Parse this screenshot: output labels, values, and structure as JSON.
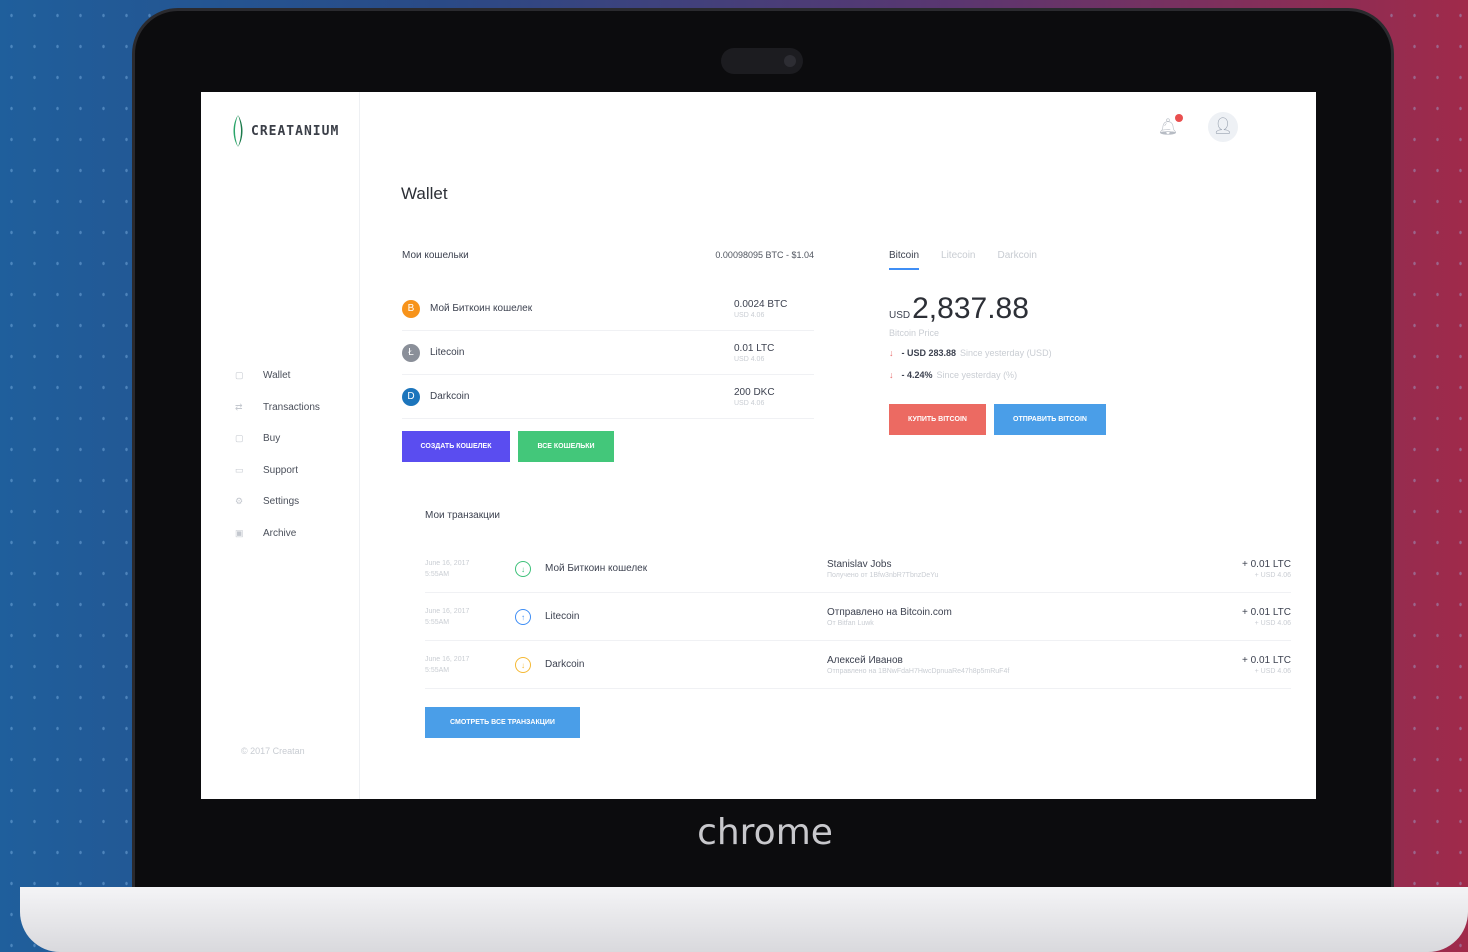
{
  "device_brand": "chrome",
  "brand": {
    "name": "CREATANIUM"
  },
  "sidebar": {
    "items": [
      {
        "icon": "wallet-icon",
        "label": "Wallet"
      },
      {
        "icon": "transactions-icon",
        "label": "Transactions"
      },
      {
        "icon": "buy-icon",
        "label": "Buy"
      },
      {
        "icon": "support-icon",
        "label": "Support"
      },
      {
        "icon": "settings-icon",
        "label": "Settings"
      },
      {
        "icon": "archive-icon",
        "label": "Archive"
      }
    ],
    "copyright": "© 2017 Creatan"
  },
  "header": {
    "notification_icon": "bell-icon",
    "avatar_icon": "user-icon"
  },
  "page": {
    "title": "Wallet"
  },
  "wallets": {
    "title": "Мои кошельки",
    "total": "0.00098095 BTC - $1.04",
    "rows": [
      {
        "name": "Мой Биткоин кошелек",
        "amount": "0.0024 BTC",
        "usd": "USD 4.06",
        "coin_color": "#f7931a",
        "glyph": "B"
      },
      {
        "name": "Litecoin",
        "amount": "0.01 LTC",
        "usd": "USD 4.06",
        "coin_color": "#8a8f99",
        "glyph": "Ł"
      },
      {
        "name": "Darkcoin",
        "amount": "200 DKC",
        "usd": "USD 4.06",
        "coin_color": "#1c75bc",
        "glyph": "D"
      }
    ],
    "btn_create": "СОЗДАТЬ КОШЕЛЕК",
    "btn_all": "ВСЕ КОШЕЛЬКИ"
  },
  "price": {
    "tabs": [
      "Bitcoin",
      "Litecoin",
      "Darkcoin"
    ],
    "currency": "USD",
    "value": "2,837.88",
    "label": "Bitcoin Price",
    "change_usd": "- USD 283.88",
    "change_usd_note": "Since yesterday (USD)",
    "change_pct": "- 4.24%",
    "change_pct_note": "Since yesterday (%)",
    "btn_buy": "КУПИТЬ BITCOIN",
    "btn_send": "ОТПРАВИТЬ BITCOIN"
  },
  "transactions": {
    "title": "Мои транзакции",
    "rows": [
      {
        "date": "June 16, 2017",
        "time": "5:55AM",
        "wallet": "Мой Биткоин кошелек",
        "party": "Stanislav Jobs",
        "detail": "Получено от 1Bfw3nbR7TbnzDeYu",
        "amount": "+ 0.01 LTC",
        "usd": "+ USD 4.06",
        "icon_color": "#3ec17a"
      },
      {
        "date": "June 16, 2017",
        "time": "5:55AM",
        "wallet": "Litecoin",
        "party": "Отправлено на Bitcoin.com",
        "detail": "От Bitfan Luwk",
        "amount": "+ 0.01 LTC",
        "usd": "+ USD 4.06",
        "icon_color": "#3f8ef5"
      },
      {
        "date": "June 16, 2017",
        "time": "5:55AM",
        "wallet": "Darkcoin",
        "party": "Алексей Иванов",
        "detail": "Отправлено на 1BNwFdaH7HwcDpnuaRe47h8p5mRuF4f",
        "amount": "+ 0.01 LTC",
        "usd": "+ USD 4.06",
        "icon_color": "#f5b935"
      }
    ],
    "btn_all": "СМОТРЕТЬ ВСЕ ТРАНЗАКЦИИ"
  },
  "colors": {
    "accent": "#3f8ef5",
    "purple": "#5a4df0",
    "green": "#43c77a",
    "red": "#ec6a62",
    "blue": "#4a9ee8"
  }
}
